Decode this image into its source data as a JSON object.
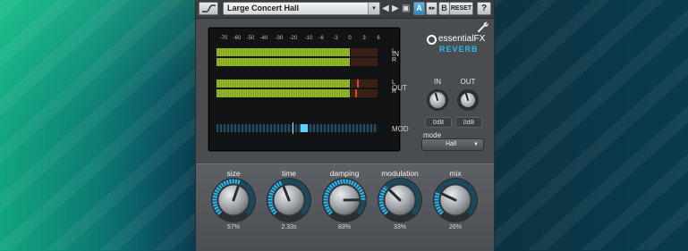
{
  "toolbar": {
    "curve_icon": "curve-icon",
    "preset_name": "Large Concert Hall",
    "dropdown_glyph": "▾",
    "prev_glyph": "◀",
    "next_glyph": "▶",
    "save_glyph": "▣",
    "ab_a": "A",
    "ab_copy": "●▸",
    "ab_b": "B",
    "reset_label": "RESET",
    "help_label": "?"
  },
  "meters": {
    "scale": [
      "-70",
      "-60",
      "-50",
      "-40",
      "-30",
      "-20",
      "-10",
      "-6",
      "-3",
      "0",
      "3",
      "6"
    ],
    "in_label": "IN",
    "out_label": "OUT",
    "mod_label": "MOD",
    "left_channel": "L",
    "right_channel": "R",
    "in_level": 0.83,
    "out_level": 0.83,
    "mod_position": 0.56,
    "colors": {
      "meter_green": "#9bbf2a",
      "peak_red": "#e0452a",
      "mod_blue": "#5ed2ff"
    }
  },
  "logo": {
    "brand": "essentialFX",
    "product": "REVERB"
  },
  "settings_icon": "wrench-icon",
  "gain": {
    "in_label": "IN",
    "out_label": "OUT",
    "in_value": "0dB",
    "out_value": "0dB"
  },
  "mode": {
    "label": "mode",
    "value": "Hall",
    "arrow": "▼"
  },
  "knobs": [
    {
      "label": "size",
      "value": "57%",
      "level": 0.57
    },
    {
      "label": "time",
      "value": "2.33s",
      "level": 0.42
    },
    {
      "label": "damping",
      "value": "83%",
      "level": 0.83
    },
    {
      "label": "modulation",
      "value": "33%",
      "level": 0.33
    },
    {
      "label": "mix",
      "value": "26%",
      "level": 0.26
    }
  ],
  "colors": {
    "accent": "#2fb7e8",
    "panel": "#4a4d50"
  }
}
